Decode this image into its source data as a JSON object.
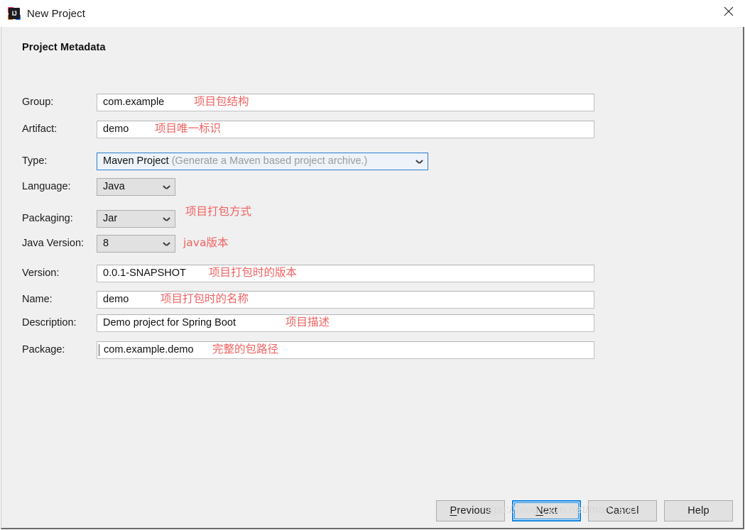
{
  "window": {
    "title": "New Project",
    "app_icon": "intellij-idea-icon",
    "close_icon": "close-icon"
  },
  "section": {
    "title": "Project Metadata"
  },
  "fields": {
    "group": {
      "label": "Group:",
      "value": "com.example",
      "note": "项目包结构"
    },
    "artifact": {
      "label": "Artifact:",
      "value": "demo",
      "note": "项目唯一标识"
    },
    "type": {
      "label": "Type:",
      "value": "Maven Project",
      "hint": "(Generate a Maven based project archive.)",
      "note": ""
    },
    "language": {
      "label": "Language:",
      "value": "Java",
      "note": ""
    },
    "packaging": {
      "label": "Packaging:",
      "value": "Jar",
      "note": "项目打包方式"
    },
    "java_version": {
      "label": "Java Version:",
      "value": "8",
      "note": "java版本"
    },
    "version": {
      "label": "Version:",
      "value": "0.0.1-SNAPSHOT",
      "note": "项目打包时的版本"
    },
    "name": {
      "label": "Name:",
      "value": "demo",
      "note": "项目打包时的名称"
    },
    "description": {
      "label": "Description:",
      "value": "Demo project for Spring Boot",
      "note": "项目描述"
    },
    "package": {
      "label": "Package:",
      "value": "com.example.demo",
      "note": "完整的包路径"
    }
  },
  "buttons": {
    "previous": {
      "pre": "P",
      "post": "revious"
    },
    "next": {
      "pre": "N",
      "post": "ext"
    },
    "cancel": {
      "pre": "C",
      "post": "ancel"
    },
    "help": {
      "pre": "H",
      "post": "elp"
    }
  },
  "watermark": "https://blog.csdn.net/man_zuo",
  "colors": {
    "accent": "#1184e0",
    "focus_border": "#2a7fd4",
    "note_red": "#f26161",
    "panel_bg": "#f0f0f0",
    "control_bg": "#e1e1e1"
  }
}
